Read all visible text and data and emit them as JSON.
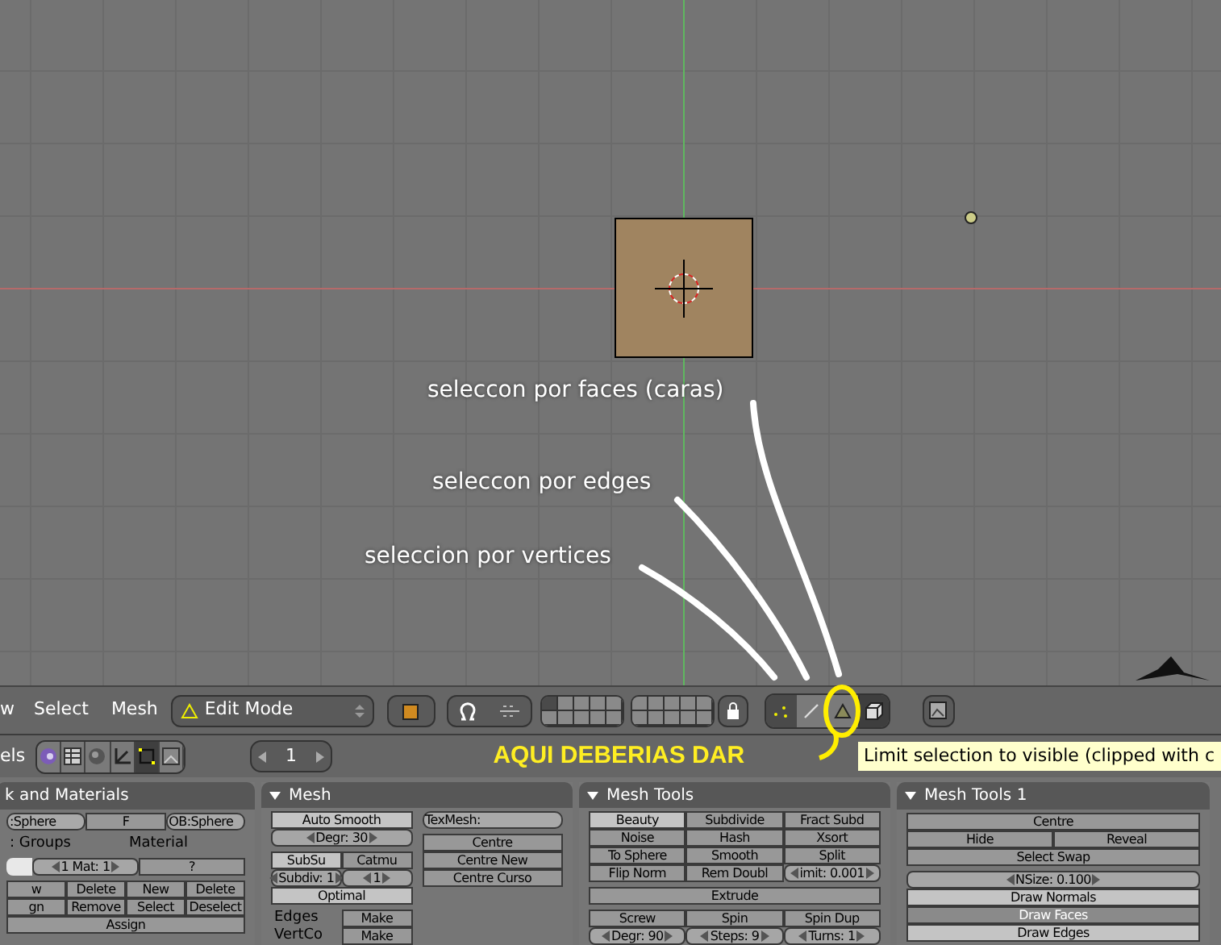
{
  "viewport": {
    "annotations": [
      {
        "text": "seleccon por faces (caras)"
      },
      {
        "text": "seleccon por edges"
      },
      {
        "text": "seleccion por vertices"
      }
    ],
    "callout": "AQUI DEBERIAS DAR"
  },
  "view_header": {
    "menus": [
      "w",
      "Select",
      "Mesh"
    ],
    "mode": "Edit Mode",
    "layers": [
      {
        "on": true
      },
      {
        "on": false
      },
      {
        "on": false
      },
      {
        "on": false
      },
      {
        "on": false
      },
      {
        "on": false
      },
      {
        "on": false
      },
      {
        "on": false
      },
      {
        "on": false
      },
      {
        "on": false
      },
      {
        "on": false
      },
      {
        "on": false
      },
      {
        "on": false
      },
      {
        "on": false
      },
      {
        "on": false
      },
      {
        "on": false
      },
      {
        "on": false
      },
      {
        "on": false
      },
      {
        "on": false
      },
      {
        "on": false
      }
    ],
    "select_modes": [
      {
        "kind": "vertex",
        "selected": true
      },
      {
        "kind": "edge",
        "selected": false
      },
      {
        "kind": "face",
        "selected": false
      }
    ],
    "occlude": {
      "on": true
    }
  },
  "buttons_header": {
    "label": "els",
    "tabs": [
      {
        "kind": "logic",
        "selected": false
      },
      {
        "kind": "script",
        "selected": false
      },
      {
        "kind": "shading",
        "selected": false
      },
      {
        "kind": "object",
        "selected": false
      },
      {
        "kind": "editing",
        "selected": true
      },
      {
        "kind": "scene",
        "selected": false
      }
    ],
    "frame": "1",
    "tooltip": "Limit selection to visible (clipped with c"
  },
  "panels": [
    {
      "title": "k and Materials",
      "columns": [
        {
          "groups": [
            {
              "rows": [
                [
                  {
                    "kind": "text",
                    "label": ":Sphere"
                  },
                  {
                    "kind": "button",
                    "label": "F"
                  },
                  {
                    "kind": "text",
                    "label": "OB:Sphere"
                  }
                ]
              ]
            },
            {
              "rows": [
                [
                  {
                    "kind": "label",
                    "label": ": Groups"
                  },
                  {
                    "kind": "label",
                    "label": "Material"
                  }
                ]
              ]
            },
            {
              "rows": [
                [
                  {
                    "kind": "swatch"
                  },
                  {
                    "kind": "number",
                    "label": "1 Mat: 1"
                  },
                  {
                    "kind": "button",
                    "label": "?"
                  }
                ]
              ]
            },
            {
              "rows": [
                [
                  {
                    "kind": "button",
                    "label": "w"
                  },
                  {
                    "kind": "button",
                    "label": "Delete"
                  },
                  {
                    "kind": "button",
                    "label": "New"
                  },
                  {
                    "kind": "button",
                    "label": "Delete"
                  }
                ],
                [
                  {
                    "kind": "button",
                    "label": "gn"
                  },
                  {
                    "kind": "button",
                    "label": "Remove"
                  },
                  {
                    "kind": "button",
                    "label": "Select"
                  },
                  {
                    "kind": "button",
                    "label": "Deselect"
                  }
                ],
                [
                  {
                    "kind": "button",
                    "label": "Assign"
                  }
                ]
              ]
            }
          ]
        }
      ]
    },
    {
      "title": "Mesh",
      "columns": [
        {
          "groups": [
            {
              "rows": [
                [
                  {
                    "kind": "toggle",
                    "label": "Auto Smooth",
                    "on": true
                  }
                ],
                [
                  {
                    "kind": "number",
                    "label": "Degr: 30"
                  }
                ]
              ]
            },
            {
              "rows": [
                [
                  {
                    "kind": "toggle",
                    "label": "SubSu",
                    "on": true
                  },
                  {
                    "kind": "button",
                    "label": "Catmu"
                  }
                ],
                [
                  {
                    "kind": "number",
                    "label": "Subdiv: 1"
                  },
                  {
                    "kind": "number",
                    "label": "1"
                  }
                ],
                [
                  {
                    "kind": "toggle",
                    "label": "Optimal",
                    "on": true
                  }
                ]
              ]
            },
            {
              "rows": [
                [
                  {
                    "kind": "label",
                    "label": "Edges"
                  },
                  {
                    "kind": "button",
                    "label": "Make"
                  }
                ],
                [
                  {
                    "kind": "label",
                    "label": "VertCo"
                  },
                  {
                    "kind": "button",
                    "label": "Make"
                  }
                ]
              ]
            }
          ]
        },
        {
          "groups": [
            {
              "rows": [
                [
                  {
                    "kind": "text",
                    "label": "TexMesh:"
                  }
                ]
              ]
            },
            {
              "rows": [
                [
                  {
                    "kind": "button",
                    "label": "Centre"
                  }
                ],
                [
                  {
                    "kind": "button",
                    "label": "Centre New"
                  }
                ],
                [
                  {
                    "kind": "button",
                    "label": "Centre Curso"
                  }
                ]
              ]
            }
          ]
        }
      ]
    },
    {
      "title": "Mesh Tools",
      "columns": [
        {
          "groups": [
            {
              "rows": [
                [
                  {
                    "kind": "toggle",
                    "label": "Beauty",
                    "on": true
                  },
                  {
                    "kind": "button",
                    "label": "Subdivide"
                  },
                  {
                    "kind": "button",
                    "label": "Fract Subd"
                  }
                ],
                [
                  {
                    "kind": "button",
                    "label": "Noise"
                  },
                  {
                    "kind": "button",
                    "label": "Hash"
                  },
                  {
                    "kind": "button",
                    "label": "Xsort"
                  }
                ],
                [
                  {
                    "kind": "button",
                    "label": "To Sphere"
                  },
                  {
                    "kind": "button",
                    "label": "Smooth"
                  },
                  {
                    "kind": "button",
                    "label": "Split"
                  }
                ],
                [
                  {
                    "kind": "button",
                    "label": "Flip Norm"
                  },
                  {
                    "kind": "button",
                    "label": "Rem Doubl"
                  },
                  {
                    "kind": "number",
                    "label": "imit: 0.001"
                  }
                ]
              ]
            },
            {
              "rows": [
                [
                  {
                    "kind": "button",
                    "label": "Extrude"
                  }
                ]
              ]
            },
            {
              "rows": [
                [
                  {
                    "kind": "button",
                    "label": "Screw"
                  },
                  {
                    "kind": "button",
                    "label": "Spin"
                  },
                  {
                    "kind": "button",
                    "label": "Spin Dup"
                  }
                ],
                [
                  {
                    "kind": "number",
                    "label": "Degr: 90"
                  },
                  {
                    "kind": "number",
                    "label": "Steps: 9"
                  },
                  {
                    "kind": "number",
                    "label": "Turns: 1"
                  }
                ]
              ]
            }
          ]
        }
      ]
    },
    {
      "title": "Mesh Tools 1",
      "columns": [
        {
          "groups": [
            {
              "rows": [
                [
                  {
                    "kind": "button",
                    "label": "Centre"
                  }
                ],
                [
                  {
                    "kind": "button",
                    "label": "Hide"
                  },
                  {
                    "kind": "button",
                    "label": "Reveal"
                  }
                ],
                [
                  {
                    "kind": "button",
                    "label": "Select Swap"
                  }
                ]
              ]
            },
            {
              "rows": [
                [
                  {
                    "kind": "number",
                    "label": "NSize: 0.100"
                  }
                ],
                [
                  {
                    "kind": "toggle",
                    "label": "Draw Normals",
                    "on": true
                  }
                ],
                [
                  {
                    "kind": "toggle",
                    "label": "Draw Faces",
                    "on": false
                  }
                ],
                [
                  {
                    "kind": "toggle",
                    "label": "Draw Edges",
                    "on": true
                  }
                ]
              ]
            }
          ]
        }
      ]
    }
  ]
}
